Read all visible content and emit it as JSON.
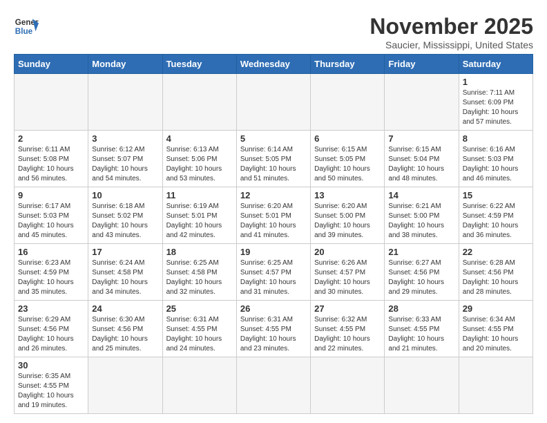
{
  "logo": {
    "line1": "General",
    "line2": "Blue"
  },
  "header": {
    "title": "November 2025",
    "subtitle": "Saucier, Mississippi, United States"
  },
  "days_of_week": [
    "Sunday",
    "Monday",
    "Tuesday",
    "Wednesday",
    "Thursday",
    "Friday",
    "Saturday"
  ],
  "weeks": [
    [
      {
        "day": "",
        "info": ""
      },
      {
        "day": "",
        "info": ""
      },
      {
        "day": "",
        "info": ""
      },
      {
        "day": "",
        "info": ""
      },
      {
        "day": "",
        "info": ""
      },
      {
        "day": "",
        "info": ""
      },
      {
        "day": "1",
        "info": "Sunrise: 7:11 AM\nSunset: 6:09 PM\nDaylight: 10 hours and 57 minutes."
      }
    ],
    [
      {
        "day": "2",
        "info": "Sunrise: 6:11 AM\nSunset: 5:08 PM\nDaylight: 10 hours and 56 minutes."
      },
      {
        "day": "3",
        "info": "Sunrise: 6:12 AM\nSunset: 5:07 PM\nDaylight: 10 hours and 54 minutes."
      },
      {
        "day": "4",
        "info": "Sunrise: 6:13 AM\nSunset: 5:06 PM\nDaylight: 10 hours and 53 minutes."
      },
      {
        "day": "5",
        "info": "Sunrise: 6:14 AM\nSunset: 5:05 PM\nDaylight: 10 hours and 51 minutes."
      },
      {
        "day": "6",
        "info": "Sunrise: 6:15 AM\nSunset: 5:05 PM\nDaylight: 10 hours and 50 minutes."
      },
      {
        "day": "7",
        "info": "Sunrise: 6:15 AM\nSunset: 5:04 PM\nDaylight: 10 hours and 48 minutes."
      },
      {
        "day": "8",
        "info": "Sunrise: 6:16 AM\nSunset: 5:03 PM\nDaylight: 10 hours and 46 minutes."
      }
    ],
    [
      {
        "day": "9",
        "info": "Sunrise: 6:17 AM\nSunset: 5:03 PM\nDaylight: 10 hours and 45 minutes."
      },
      {
        "day": "10",
        "info": "Sunrise: 6:18 AM\nSunset: 5:02 PM\nDaylight: 10 hours and 43 minutes."
      },
      {
        "day": "11",
        "info": "Sunrise: 6:19 AM\nSunset: 5:01 PM\nDaylight: 10 hours and 42 minutes."
      },
      {
        "day": "12",
        "info": "Sunrise: 6:20 AM\nSunset: 5:01 PM\nDaylight: 10 hours and 41 minutes."
      },
      {
        "day": "13",
        "info": "Sunrise: 6:20 AM\nSunset: 5:00 PM\nDaylight: 10 hours and 39 minutes."
      },
      {
        "day": "14",
        "info": "Sunrise: 6:21 AM\nSunset: 5:00 PM\nDaylight: 10 hours and 38 minutes."
      },
      {
        "day": "15",
        "info": "Sunrise: 6:22 AM\nSunset: 4:59 PM\nDaylight: 10 hours and 36 minutes."
      }
    ],
    [
      {
        "day": "16",
        "info": "Sunrise: 6:23 AM\nSunset: 4:59 PM\nDaylight: 10 hours and 35 minutes."
      },
      {
        "day": "17",
        "info": "Sunrise: 6:24 AM\nSunset: 4:58 PM\nDaylight: 10 hours and 34 minutes."
      },
      {
        "day": "18",
        "info": "Sunrise: 6:25 AM\nSunset: 4:58 PM\nDaylight: 10 hours and 32 minutes."
      },
      {
        "day": "19",
        "info": "Sunrise: 6:25 AM\nSunset: 4:57 PM\nDaylight: 10 hours and 31 minutes."
      },
      {
        "day": "20",
        "info": "Sunrise: 6:26 AM\nSunset: 4:57 PM\nDaylight: 10 hours and 30 minutes."
      },
      {
        "day": "21",
        "info": "Sunrise: 6:27 AM\nSunset: 4:56 PM\nDaylight: 10 hours and 29 minutes."
      },
      {
        "day": "22",
        "info": "Sunrise: 6:28 AM\nSunset: 4:56 PM\nDaylight: 10 hours and 28 minutes."
      }
    ],
    [
      {
        "day": "23",
        "info": "Sunrise: 6:29 AM\nSunset: 4:56 PM\nDaylight: 10 hours and 26 minutes."
      },
      {
        "day": "24",
        "info": "Sunrise: 6:30 AM\nSunset: 4:56 PM\nDaylight: 10 hours and 25 minutes."
      },
      {
        "day": "25",
        "info": "Sunrise: 6:31 AM\nSunset: 4:55 PM\nDaylight: 10 hours and 24 minutes."
      },
      {
        "day": "26",
        "info": "Sunrise: 6:31 AM\nSunset: 4:55 PM\nDaylight: 10 hours and 23 minutes."
      },
      {
        "day": "27",
        "info": "Sunrise: 6:32 AM\nSunset: 4:55 PM\nDaylight: 10 hours and 22 minutes."
      },
      {
        "day": "28",
        "info": "Sunrise: 6:33 AM\nSunset: 4:55 PM\nDaylight: 10 hours and 21 minutes."
      },
      {
        "day": "29",
        "info": "Sunrise: 6:34 AM\nSunset: 4:55 PM\nDaylight: 10 hours and 20 minutes."
      }
    ],
    [
      {
        "day": "30",
        "info": "Sunrise: 6:35 AM\nSunset: 4:55 PM\nDaylight: 10 hours and 19 minutes."
      },
      {
        "day": "",
        "info": ""
      },
      {
        "day": "",
        "info": ""
      },
      {
        "day": "",
        "info": ""
      },
      {
        "day": "",
        "info": ""
      },
      {
        "day": "",
        "info": ""
      },
      {
        "day": "",
        "info": ""
      }
    ]
  ]
}
